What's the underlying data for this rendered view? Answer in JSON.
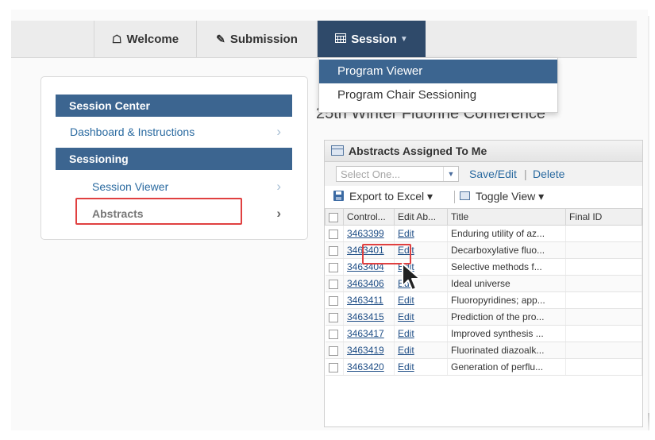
{
  "nav": {
    "welcome": "Welcome",
    "submission": "Submission",
    "session": "Session"
  },
  "dropdown": {
    "items": [
      "Program Viewer",
      "Program Chair Sessioning"
    ]
  },
  "sidebar": {
    "header1": "Session Center",
    "link1": "Dashboard & Instructions",
    "header2": "Sessioning",
    "link2": "Session Viewer",
    "link3": "Abstracts"
  },
  "main": {
    "conference_title": "25th Winter Fluorine Conference"
  },
  "panel": {
    "title": "Abstracts Assigned To Me",
    "select_placeholder": "Select One...",
    "save_edit": "Save/Edit",
    "separator": "|",
    "delete": "Delete",
    "export": "Export to Excel ▾",
    "toggle_view": "Toggle View ▾",
    "columns": [
      "Control...",
      "Edit Ab...",
      "Title",
      "Final ID"
    ],
    "rows": [
      {
        "control": "3463399",
        "edit": "Edit",
        "title": "Enduring utility of az..."
      },
      {
        "control": "3463401",
        "edit": "Edit",
        "title": "Decarboxylative fluo..."
      },
      {
        "control": "3463404",
        "edit": "Edit",
        "title": "Selective methods f..."
      },
      {
        "control": "3463406",
        "edit": "Edit",
        "title": "Ideal universe"
      },
      {
        "control": "3463411",
        "edit": "Edit",
        "title": "Fluoropyridines; app..."
      },
      {
        "control": "3463415",
        "edit": "Edit",
        "title": "Prediction of the pro..."
      },
      {
        "control": "3463417",
        "edit": "Edit",
        "title": "Improved synthesis ..."
      },
      {
        "control": "3463419",
        "edit": "Edit",
        "title": "Fluorinated diazoalk..."
      },
      {
        "control": "3463420",
        "edit": "Edit",
        "title": "Generation of perflu..."
      }
    ]
  },
  "colors": {
    "nav_active": "#2f4a6a",
    "header_blue": "#3c6590",
    "link_blue": "#2a6aa0",
    "highlight_red": "#e04040"
  },
  "icons": {
    "welcome": "home-icon",
    "submission": "pencil-icon",
    "session": "calendar-icon"
  }
}
